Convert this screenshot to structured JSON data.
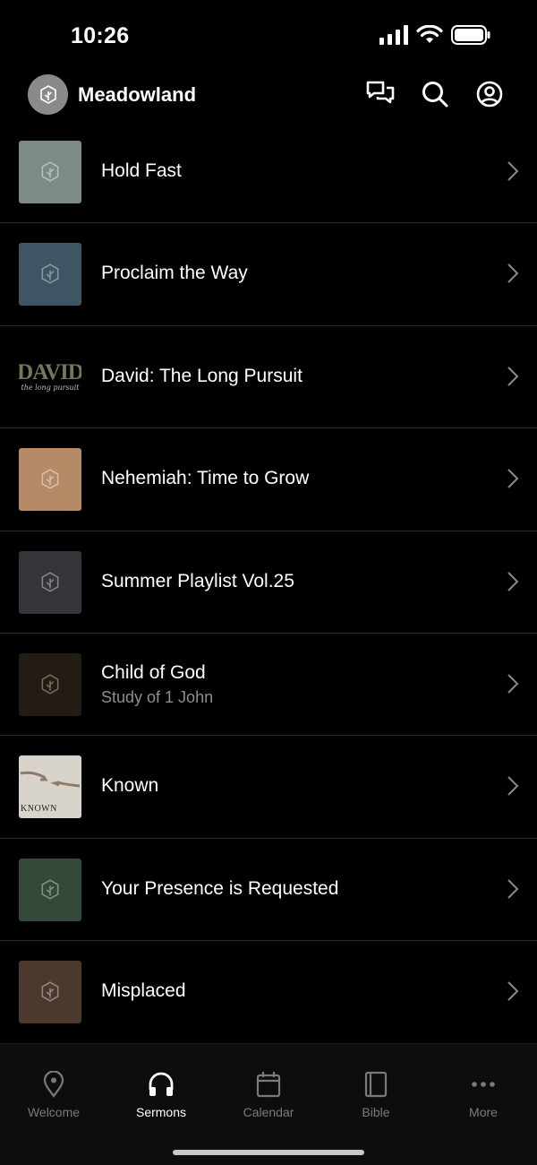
{
  "status": {
    "time": "10:26"
  },
  "header": {
    "brand": "Meadowland"
  },
  "sermons": [
    {
      "title": "Hold Fast",
      "subtitle": "",
      "thumb_color": "#7c8c85"
    },
    {
      "title": "Proclaim the Way",
      "subtitle": "",
      "thumb_color": "#3f5563"
    },
    {
      "title": "David: The Long Pursuit",
      "subtitle": "",
      "thumb_color": "#000000",
      "thumb_text": "DAVID",
      "thumb_subtext": "the long pursuit"
    },
    {
      "title": "Nehemiah: Time to Grow",
      "subtitle": "",
      "thumb_color": "#b58a66"
    },
    {
      "title": "Summer Playlist Vol.25",
      "subtitle": "",
      "thumb_color": "#35343a"
    },
    {
      "title": "Child of God",
      "subtitle": "Study of 1 John",
      "thumb_color": "#221c14"
    },
    {
      "title": "Known",
      "subtitle": "",
      "thumb_color": "#d8d4cc",
      "thumb_text": "KNOWN"
    },
    {
      "title": "Your Presence is Requested",
      "subtitle": "",
      "thumb_color": "#334a3a"
    },
    {
      "title": "Misplaced",
      "subtitle": "",
      "thumb_color": "#4c392d"
    }
  ],
  "tabs": [
    {
      "label": "Welcome",
      "icon": "location-pin-icon",
      "active": false
    },
    {
      "label": "Sermons",
      "icon": "headphones-icon",
      "active": true
    },
    {
      "label": "Calendar",
      "icon": "calendar-icon",
      "active": false
    },
    {
      "label": "Bible",
      "icon": "book-icon",
      "active": false
    },
    {
      "label": "More",
      "icon": "more-dots-icon",
      "active": false
    }
  ]
}
